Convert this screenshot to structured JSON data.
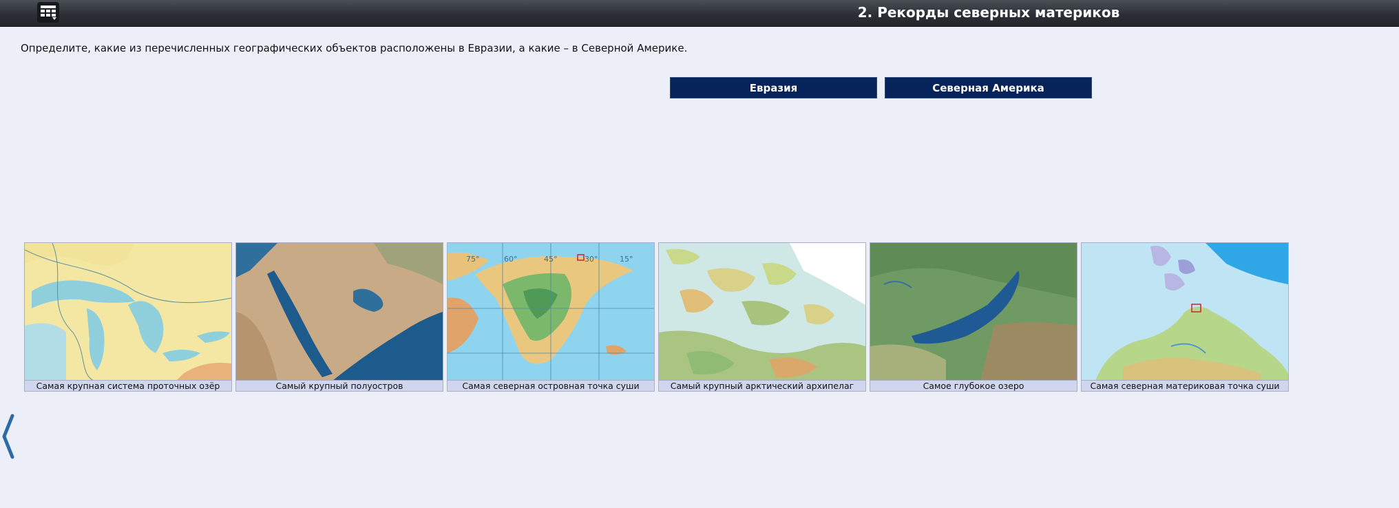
{
  "header": {
    "title": "2. Рекорды северных материков",
    "menu_icon": "grid-menu-icon"
  },
  "instruction": "Определите, какие из перечисленных географических объектов расположены в Евразии, а какие – в Северной Америке.",
  "categories": [
    {
      "label": "Евразия"
    },
    {
      "label": "Северная Америка"
    }
  ],
  "cards": [
    {
      "caption": "Самая крупная система проточных озёр",
      "map": "great-lakes-map"
    },
    {
      "caption": "Самый крупный полуостров",
      "map": "arabian-peninsula-map"
    },
    {
      "caption": "Самая северная островная точка суши",
      "map": "greenland-map"
    },
    {
      "caption": "Самый крупный арктический архипелаг",
      "map": "arctic-archipelago-map"
    },
    {
      "caption": "Самое глубокое озеро",
      "map": "baikal-map"
    },
    {
      "caption": "Самая северная материковая точка суши",
      "map": "taymyr-map"
    }
  ],
  "greenland_map_labels": [
    "75°",
    "60°",
    "45°",
    "30°",
    "15°"
  ],
  "navigation": {
    "back_icon": "chevron-left-icon"
  },
  "colors": {
    "header_bg": "#2c3036",
    "category_button_bg": "#062459",
    "caption_bg": "#d0d6ee",
    "page_bg": "#eceff8",
    "back_arrow": "#2e6aa6"
  }
}
